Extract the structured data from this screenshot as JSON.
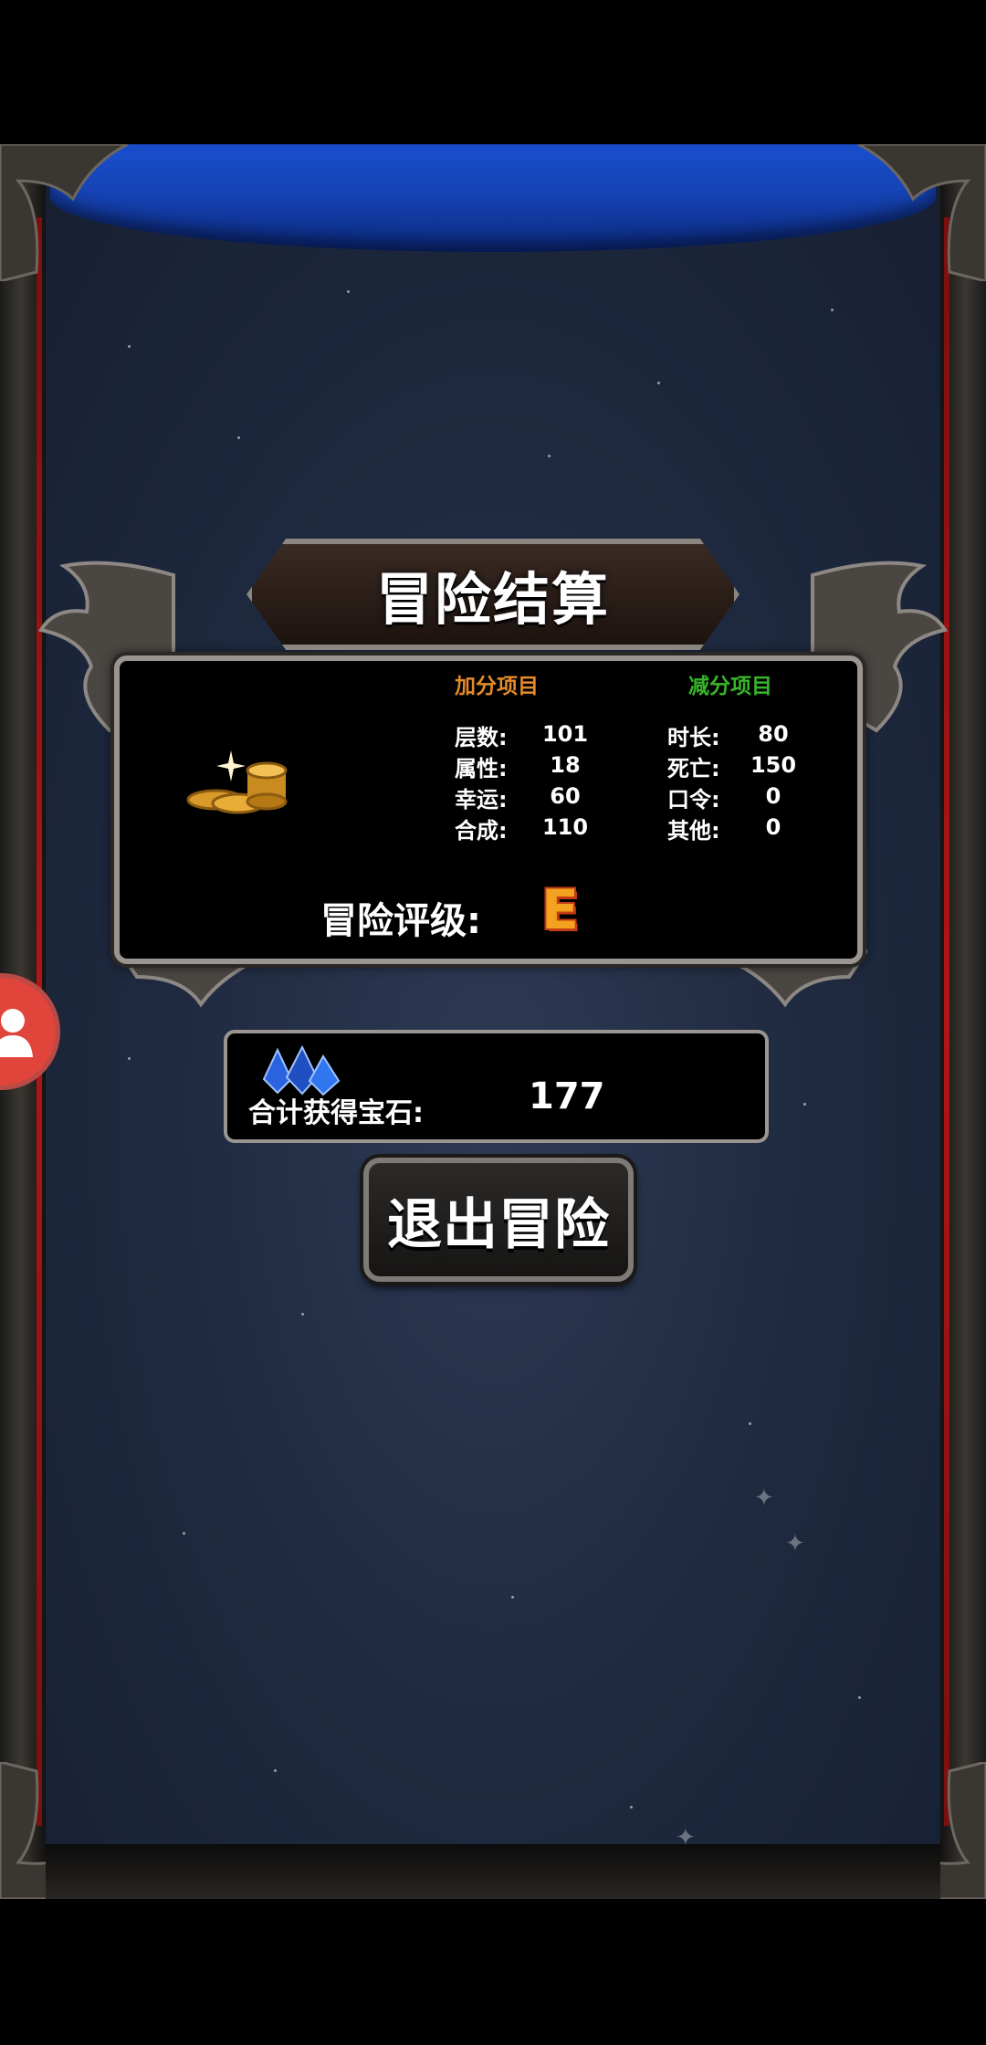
{
  "title": "冒险结算",
  "stats": {
    "bonus_header": "加分项目",
    "penalty_header": "减分项目",
    "bonus_items": [
      {
        "label": "层数:",
        "value": "101"
      },
      {
        "label": "属性:",
        "value": "18"
      },
      {
        "label": "幸运:",
        "value": "60"
      },
      {
        "label": "合成:",
        "value": "110"
      }
    ],
    "penalty_items": [
      {
        "label": "时长:",
        "value": "80"
      },
      {
        "label": "死亡:",
        "value": "150"
      },
      {
        "label": "口令:",
        "value": "0"
      },
      {
        "label": "其他:",
        "value": "0"
      }
    ]
  },
  "rating": {
    "label": "冒险评级:",
    "value": "E"
  },
  "gems": {
    "label": "合计获得宝石:",
    "value": "177"
  },
  "exit_button": {
    "label": "退出冒险"
  },
  "colors": {
    "bonus": "#e38b2a",
    "penalty": "#37b52a",
    "rating": "#f2a21e",
    "curtain": "#1541b0"
  },
  "icons": {
    "coins": "gold-coins-icon",
    "gems": "blue-gems-icon",
    "avatar": "user-avatar-icon"
  }
}
